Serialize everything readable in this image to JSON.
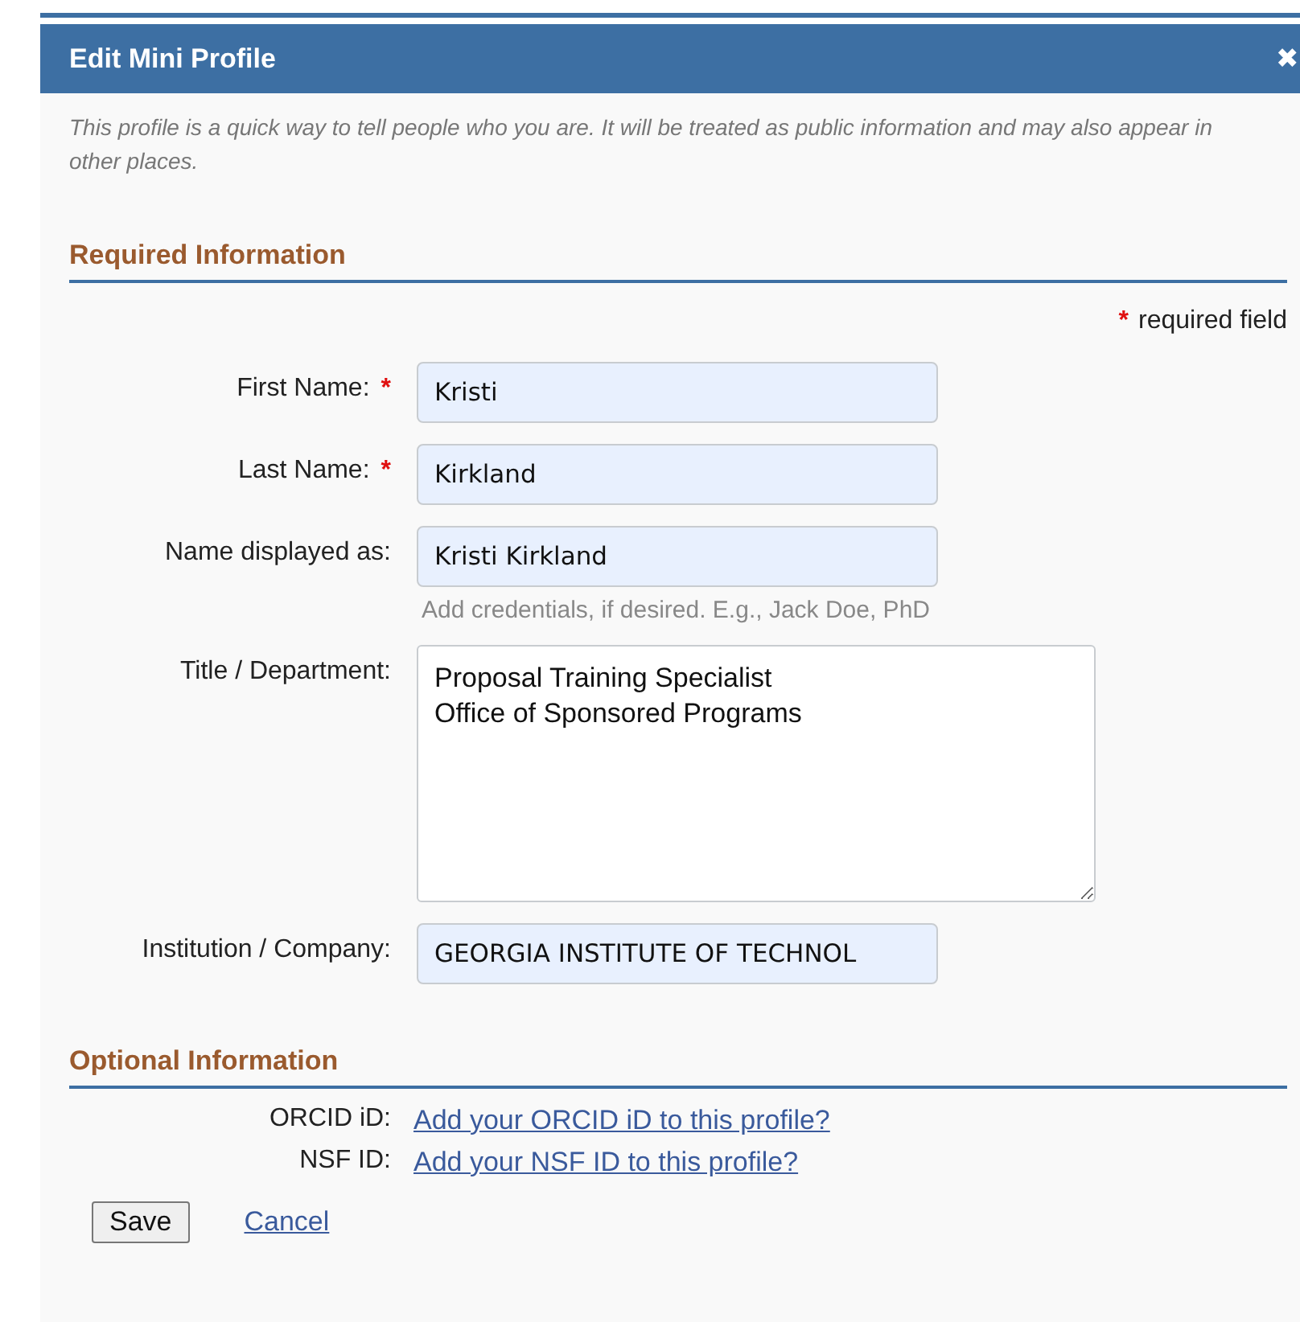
{
  "dialog": {
    "title": "Edit Mini Profile",
    "close": "✖",
    "intro": "This profile is a quick way to tell people who you are. It will be treated as public information and may also appear in other places."
  },
  "required_section": {
    "heading": "Required Information",
    "legend_mark": "*",
    "legend": "required field",
    "fields": [
      {
        "kind": "input",
        "label": "First Name:",
        "required": true,
        "value": "Kristi"
      },
      {
        "kind": "input",
        "label": "Last Name:",
        "required": true,
        "value": "Kirkland"
      },
      {
        "kind": "input",
        "label": "Name displayed as:",
        "required": false,
        "value": "Kristi Kirkland",
        "hint": "Add credentials, if desired. E.g., Jack Doe, PhD"
      },
      {
        "kind": "textarea",
        "label": "Title / Department:",
        "required": false,
        "value": "Proposal Training Specialist\nOffice of Sponsored Programs"
      },
      {
        "kind": "input",
        "label": "Institution / Company:",
        "required": false,
        "value": "GEORGIA INSTITUTE OF TECHNOL"
      }
    ]
  },
  "optional_section": {
    "heading": "Optional Information",
    "links": [
      {
        "label": "ORCID iD:",
        "link": "Add your ORCID iD to this profile?"
      },
      {
        "label": "NSF ID:",
        "link": "Add your NSF ID to this profile?"
      }
    ]
  },
  "buttons": {
    "save": "Save",
    "cancel": "Cancel"
  }
}
